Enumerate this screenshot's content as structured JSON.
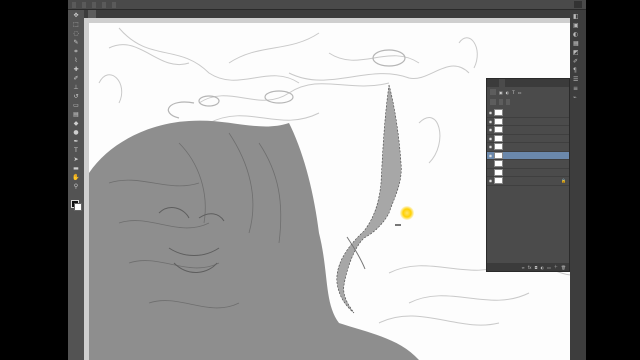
{
  "options_bar": {
    "chips": [
      "",
      "",
      "",
      "",
      ""
    ],
    "workspace": ""
  },
  "document": {
    "tab_label": "",
    "tooltip": ""
  },
  "tools": [
    "",
    "",
    "",
    "",
    "",
    "",
    "",
    "",
    "",
    "",
    "",
    "",
    "",
    "",
    "",
    "",
    "",
    "",
    "",
    "",
    "",
    ""
  ],
  "layers_panel": {
    "tabs": [
      "",
      "",
      ""
    ],
    "active_tab_index": 2,
    "kind_filter": "",
    "blend_mode": "",
    "opacity_value": "",
    "fill_value": "",
    "layers": [
      {
        "name": "",
        "visible": true
      },
      {
        "name": "",
        "visible": true
      },
      {
        "name": "",
        "visible": true
      },
      {
        "name": "",
        "visible": true
      },
      {
        "name": "",
        "visible": true
      },
      {
        "name": "",
        "visible": true,
        "selected": true
      },
      {
        "name": "",
        "visible": false
      },
      {
        "name": "",
        "visible": false
      },
      {
        "name": "",
        "visible": true,
        "locked": true
      }
    ]
  },
  "colors": {
    "selected_layer": "#6b88ab",
    "panel_bg": "#4b4b4b",
    "canvas_bg": "#fdfdfd",
    "cursor_highlight": "#ffd100"
  }
}
